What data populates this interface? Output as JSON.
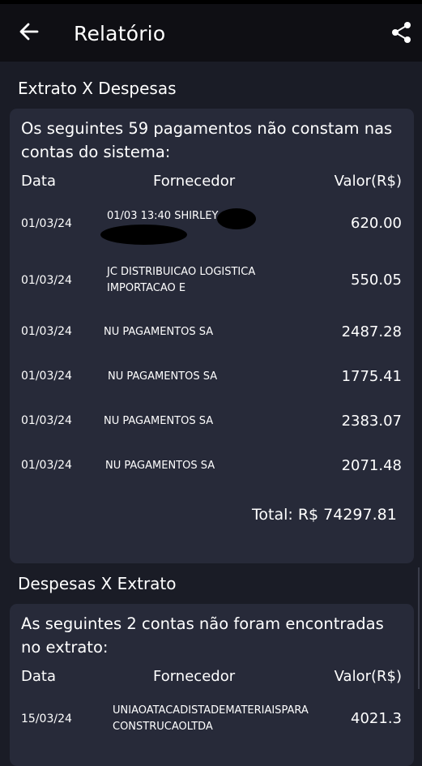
{
  "app_bar": {
    "title": "Relatório",
    "back_icon": "arrow-left-icon",
    "share_icon": "share-icon"
  },
  "section1": {
    "title": "Extrato X Despesas",
    "intro": "Os seguintes 59 pagamentos não constam nas contas do sistema:",
    "columns": {
      "date": "Data",
      "supplier": "Fornecedor",
      "value": "Valor(R$)"
    },
    "rows": [
      {
        "date": "01/03/24",
        "supplier_line1": "01/03 13:40 SHIRLEY",
        "supplier_line2": "",
        "value": "620.00"
      },
      {
        "date": "01/03/24",
        "supplier_line1": "JC DISTRIBUICAO LOGISTICA",
        "supplier_line2": "IMPORTACAO E",
        "value": "550.05"
      },
      {
        "date": "01/03/24",
        "supplier_line1": "NU PAGAMENTOS SA",
        "supplier_line2": "",
        "value": "2487.28"
      },
      {
        "date": "01/03/24",
        "supplier_line1": "NU PAGAMENTOS SA",
        "supplier_line2": "",
        "value": "1775.41"
      },
      {
        "date": "01/03/24",
        "supplier_line1": "NU PAGAMENTOS SA",
        "supplier_line2": "",
        "value": "2383.07"
      },
      {
        "date": "01/03/24",
        "supplier_line1": "NU PAGAMENTOS SA",
        "supplier_line2": "",
        "value": "2071.48"
      }
    ],
    "total": "Total: R$ 74297.81"
  },
  "section2": {
    "title": "Despesas X Extrato",
    "intro": "As seguintes 2 contas não foram encontradas no extrato:",
    "columns": {
      "date": "Data",
      "supplier": "Fornecedor",
      "value": "Valor(R$)"
    },
    "rows": [
      {
        "date": "15/03/24",
        "supplier_line1": "UNIAOATACADISTADEMATERIAISPARA",
        "supplier_line2": "CONSTRUCAOLTDA",
        "value": "4021.3"
      }
    ]
  },
  "colors": {
    "background": "#1a1c26",
    "card": "#272a39",
    "appbar": "#0f0f14",
    "text": "#ffffff"
  }
}
